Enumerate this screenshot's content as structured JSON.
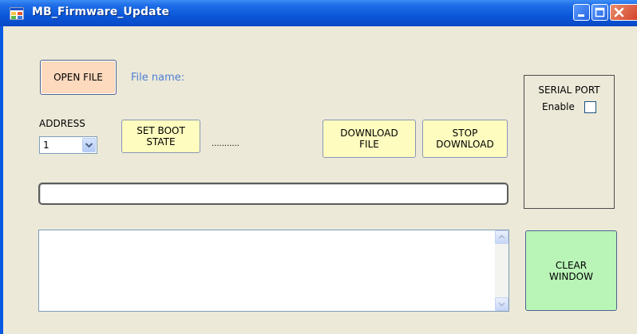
{
  "window": {
    "title": "MB_Firmware_Update"
  },
  "controls": {
    "open_file": "OPEN FILE",
    "file_name_label": "File name:",
    "address_label": "ADDRESS",
    "address_value": "1",
    "set_boot_state": "SET BOOT\nSTATE",
    "status_dots": "...........",
    "download_file": "DOWNLOAD\nFILE",
    "stop_download": "STOP\nDOWNLOAD",
    "clear_window": "CLEAR\nWINDOW"
  },
  "serial_port": {
    "title": "SERIAL PORT",
    "enable_label": "Enable",
    "enabled": false
  },
  "progress": {
    "value": 0
  },
  "colors": {
    "open_file_bg": "#fdd9bd",
    "yellow_button_bg": "#fffcbf",
    "clear_window_bg": "#b9f5b7",
    "file_name_color": "#4d7fd3",
    "client_bg": "#ece9d8"
  },
  "icons": {
    "app": "app-icon",
    "dropdown": "chevron-down-icon",
    "scroll_up": "scroll-up-arrow-icon",
    "scroll_down": "scroll-down-arrow-icon"
  }
}
